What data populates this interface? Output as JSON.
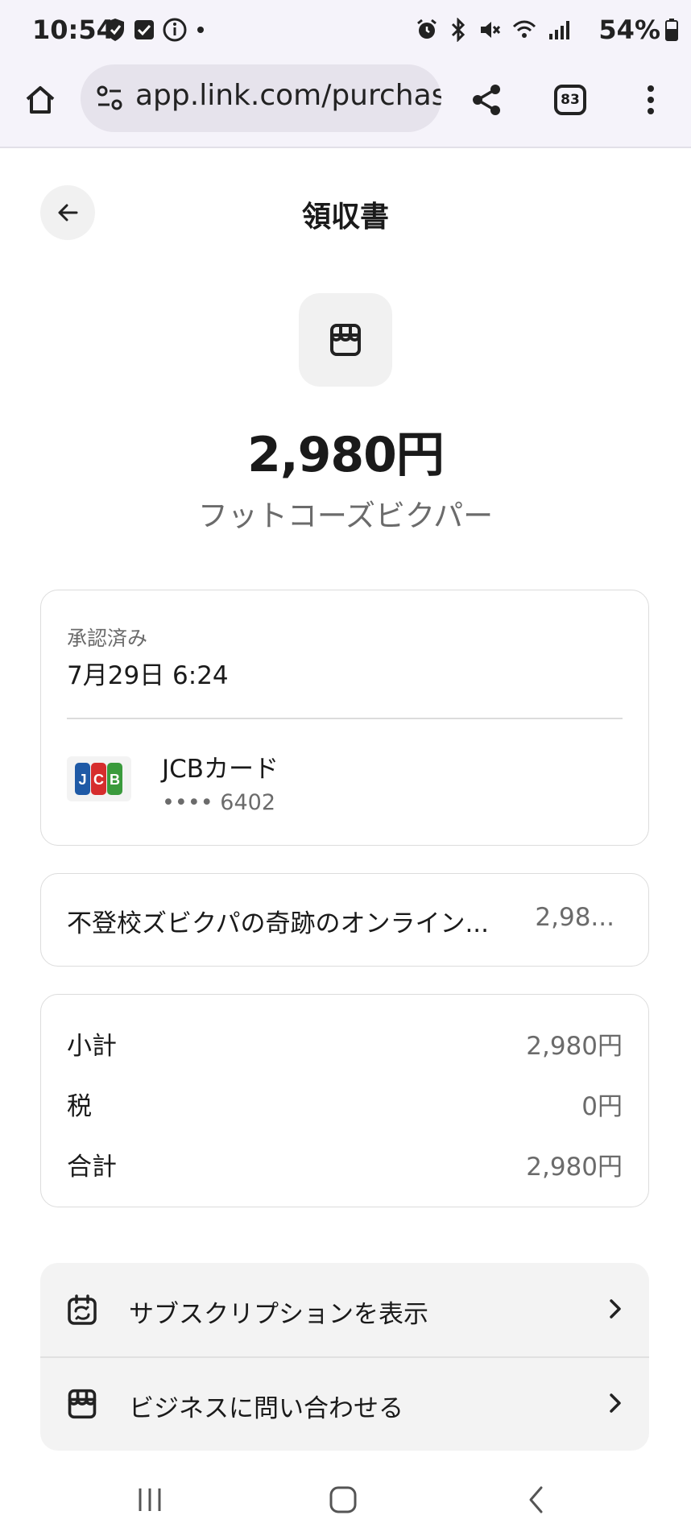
{
  "status_bar": {
    "time": "10:54",
    "battery": "54%"
  },
  "browser": {
    "url": "app.link.com/purchases",
    "tab_count": "83"
  },
  "header": {
    "title": "領収書"
  },
  "receipt": {
    "amount": "2,980円",
    "merchant": "フットコーズビクパー",
    "status_label": "承認済み",
    "datetime": "7月29日 6:24",
    "card_name": "JCBカード",
    "card_number": "•••• 6402",
    "item_name": "不登校ズビクパの奇跡のオンライン...",
    "item_price": "2,98...",
    "subtotal_label": "小計",
    "subtotal": "2,980円",
    "tax_label": "税",
    "tax": "0円",
    "total_label": "合計",
    "total": "2,980円"
  },
  "actions": {
    "view_subscription": "サブスクリプションを表示",
    "contact_business": "ビジネスに問い合わせる"
  },
  "colors": {
    "jcb_blue": "#1f5aa6",
    "jcb_red": "#d62d2d",
    "jcb_green": "#3a9a3c"
  }
}
